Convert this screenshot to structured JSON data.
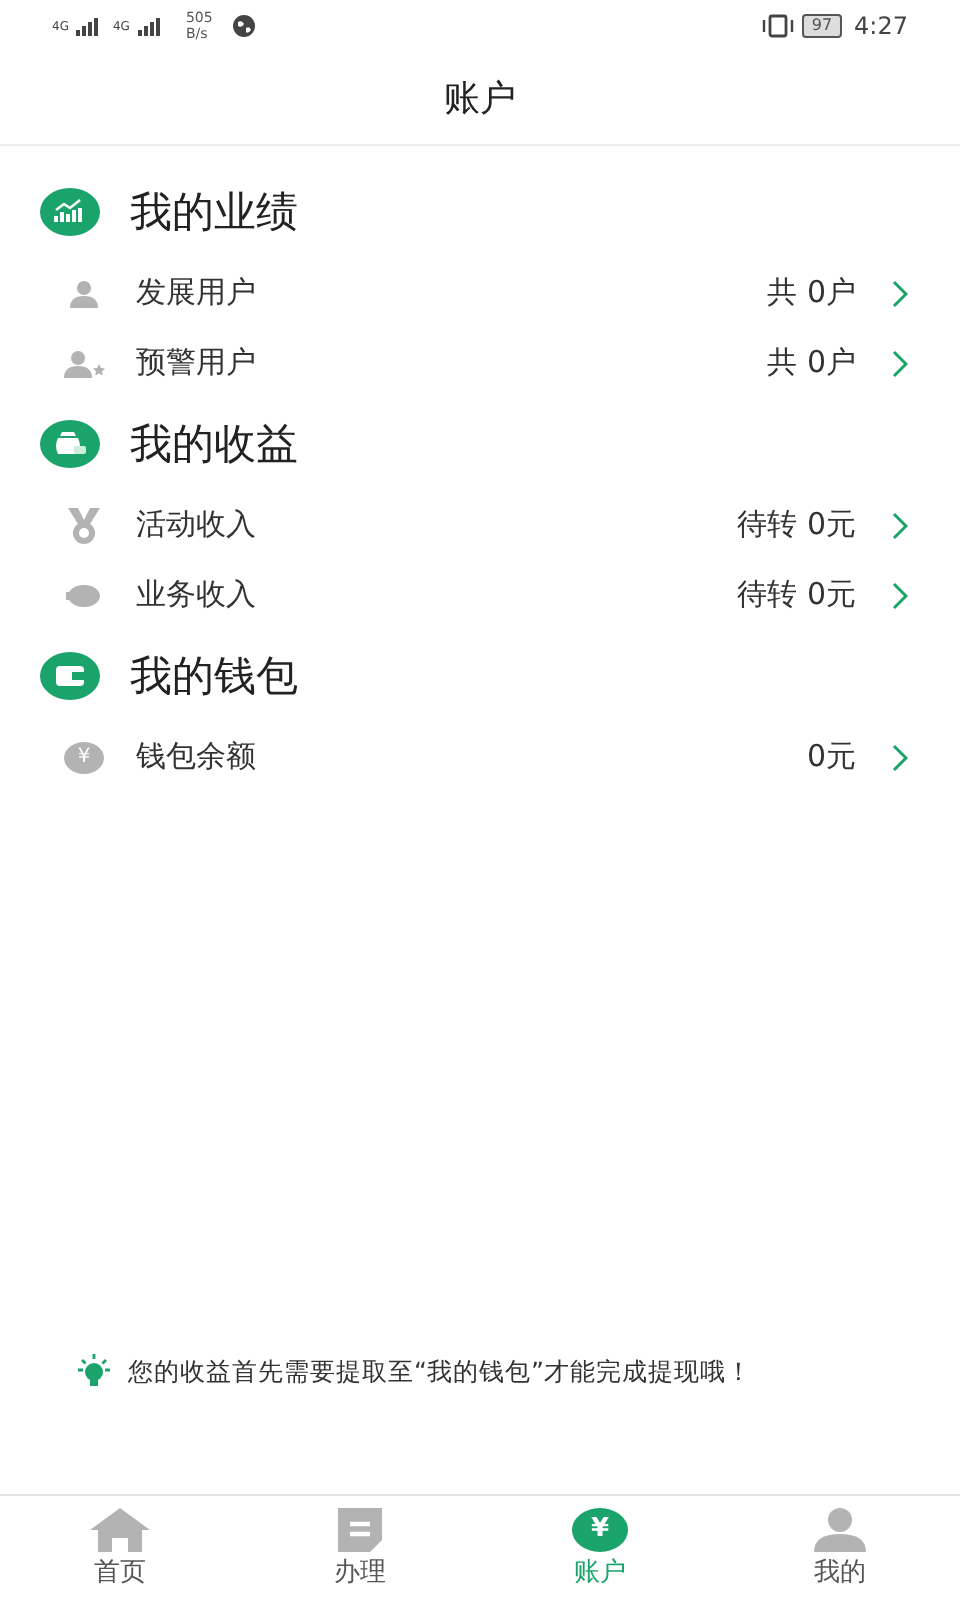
{
  "status_bar": {
    "network_1": "4G",
    "network_2": "4G",
    "speed": "505",
    "speed_unit": "B/s",
    "battery": "97",
    "time": "4:27"
  },
  "header": {
    "title": "账户"
  },
  "sections": [
    {
      "title": "我的业绩",
      "kind": "chart",
      "rows": [
        {
          "label": "发展用户",
          "kind": "person",
          "value": "共 0户"
        },
        {
          "label": "预警用户",
          "kind": "person-star",
          "value": "共 0户"
        }
      ]
    },
    {
      "title": "我的收益",
      "kind": "money-bag",
      "rows": [
        {
          "label": "活动收入",
          "kind": "medal",
          "value": "待转 0元"
        },
        {
          "label": "业务收入",
          "kind": "piggy",
          "value": "待转 0元"
        }
      ]
    },
    {
      "title": "我的钱包",
      "kind": "wallet",
      "rows": [
        {
          "label": "钱包余额",
          "kind": "coin",
          "glyph": "¥",
          "value": "0元"
        }
      ]
    }
  ],
  "tip": "您的收益首先需要提取至“我的钱包”才能完成提现哦！",
  "tabs": [
    {
      "label": "首页",
      "kind": "home",
      "selected": false
    },
    {
      "label": "办理",
      "kind": "doc",
      "selected": false
    },
    {
      "label": "账户",
      "kind": "coin",
      "glyph": "¥",
      "selected": true
    },
    {
      "label": "我的",
      "kind": "person",
      "selected": false
    }
  ]
}
